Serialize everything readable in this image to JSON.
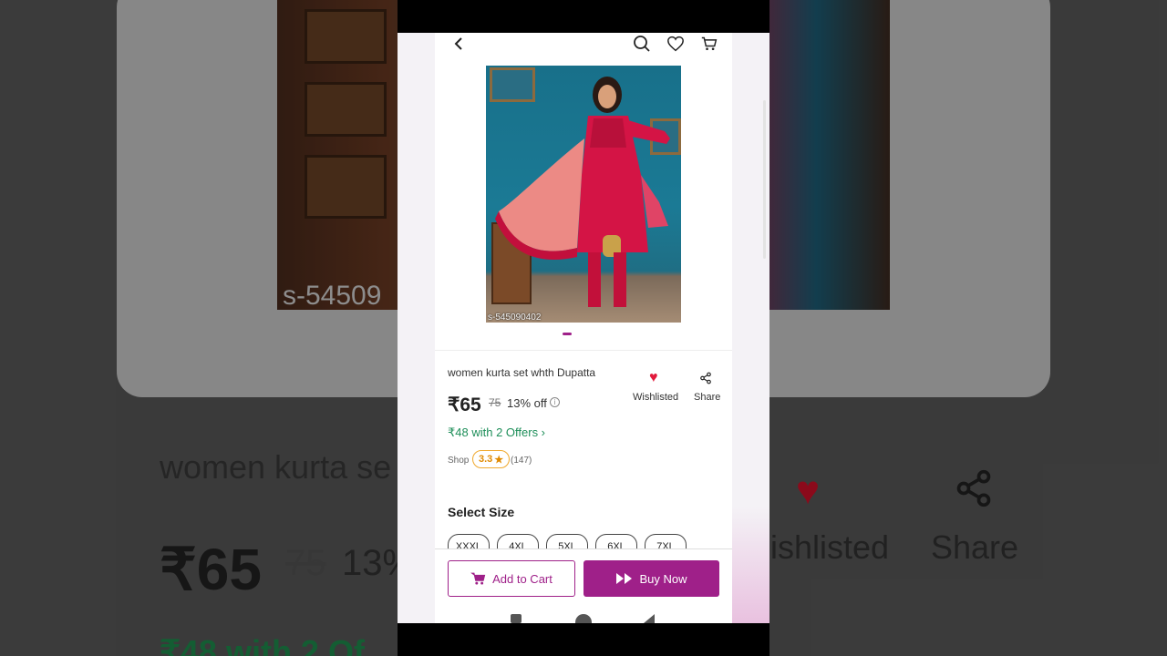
{
  "product": {
    "title": "women kurta set whth Dupatta",
    "price": "₹65",
    "mrp": "75",
    "discount": "13% off",
    "offers": "₹48 with 2 Offers ›",
    "shop_label": "Shop",
    "rating": "3.3",
    "reviews": "(147)",
    "sku": "s-545090402",
    "wishlist_label": "Wishlisted",
    "share_label": "Share"
  },
  "size_section": {
    "title": "Select Size",
    "sizes": [
      "XXXL",
      "4XL",
      "5XL",
      "6XL",
      "7XL"
    ]
  },
  "actions": {
    "add_to_cart": "Add to Cart",
    "buy_now": "Buy Now"
  },
  "background": {
    "title": "women kurta se",
    "price": "₹65",
    "mrp": "75",
    "discount": "13%",
    "offers": "₹48 with 2 Of",
    "wish": "ishlisted",
    "share": "Share",
    "sku": "s-54509"
  },
  "colors": {
    "brand": "#9f2089",
    "offer_green": "#1f8f5a",
    "heart_red": "#e21b3c",
    "rating_orange": "#f0a92e"
  }
}
